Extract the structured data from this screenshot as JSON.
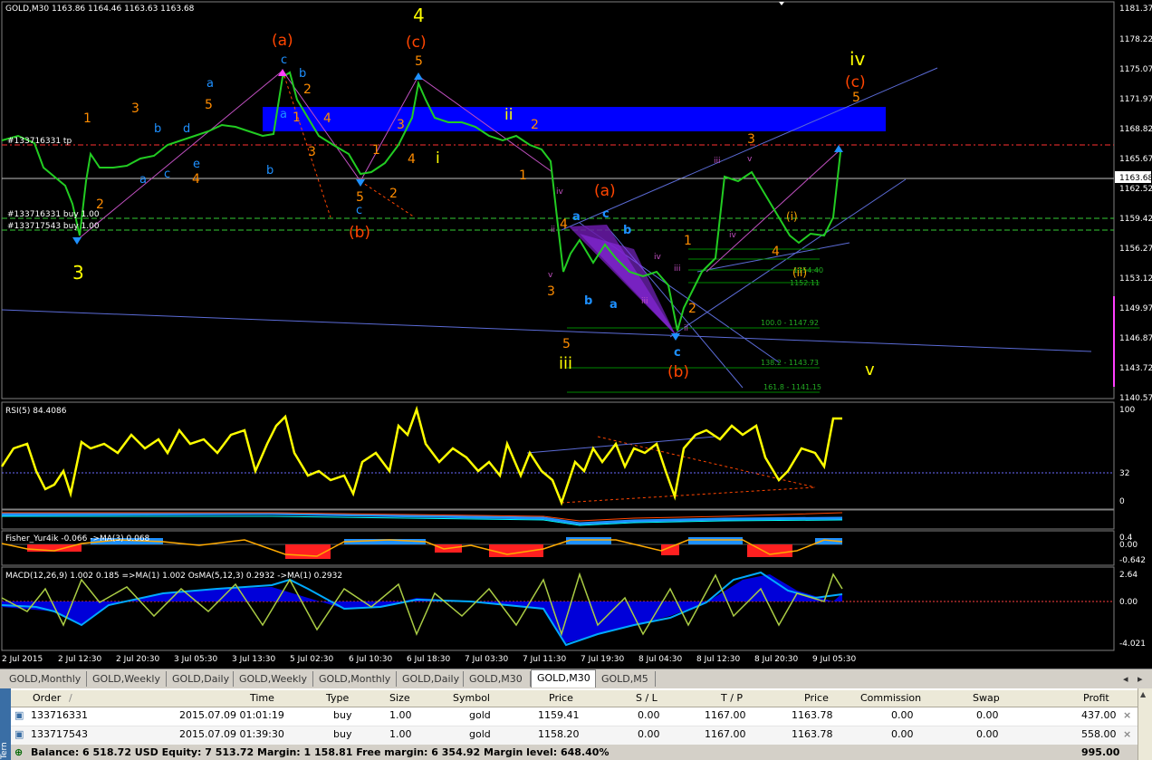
{
  "chart": {
    "symbol_info": "GOLD,M30  1163.86 1164.46 1163.63 1163.68",
    "current_price": "1163.68",
    "price_scale": [
      "1181.37",
      "1178.22",
      "1175.07",
      "1171.97",
      "1168.82",
      "1165.67",
      "1162.52",
      "1159.42",
      "1156.27",
      "1153.12",
      "1149.97",
      "1146.87",
      "1143.72",
      "1140.57"
    ],
    "order_labels": [
      "#133716331 tp",
      "#133716331 buy 1.00",
      "#133717543 buy 1.00"
    ],
    "fib_labels": [
      "100.0 - 1147.92",
      "138.2 - 1143.73",
      "161.8 - 1141.15",
      "1152.11",
      "1154.40"
    ],
    "wave_labels": {
      "big_4": "4",
      "big_3": "3",
      "a_paren_left": "(a)",
      "c_paren_top": "(c)",
      "b_paren": "(b)",
      "a_paren_mid": "(a)",
      "b_paren_bottom": "(b)",
      "iv": "iv",
      "c_paren_right": "(c)",
      "five_right": "5",
      "v": "v",
      "iii": "iii",
      "ii": "ii",
      "i": "i",
      "two": "2",
      "three": "3",
      "one": "1",
      "five": "5",
      "four": "4",
      "a": "a",
      "b": "b",
      "c": "c",
      "d": "d",
      "e": "e",
      "ii_small": "ii",
      "iii_small": "iii",
      "iv_small": "iv",
      "v_small": "v",
      "i_paren": "(i)",
      "ii_paren": "(ii)"
    },
    "rsi": {
      "title": "RSI(5) 84.4086",
      "scale": [
        "100",
        "32",
        "0"
      ]
    },
    "fisher": {
      "title": "Fisher_Yur4ik -0.066  ->MA(3) 0.068",
      "scale": [
        "0.4",
        "0.00",
        "-0.642"
      ]
    },
    "macd": {
      "title": "MACD(12,26,9) 1.002  0.185  =>MA(1) 1.002  OsMA(5,12,3) 0.2932  ->MA(1) 0.2932",
      "scale": [
        "2.64",
        "0.00",
        "-4.021"
      ]
    },
    "time_axis": [
      "2 Jul 2015",
      "2 Jul 12:30",
      "2 Jul 20:30",
      "3 Jul 05:30",
      "3 Jul 13:30",
      "5 Jul 02:30",
      "6 Jul 10:30",
      "6 Jul 18:30",
      "7 Jul 03:30",
      "7 Jul 11:30",
      "7 Jul 19:30",
      "8 Jul 04:30",
      "8 Jul 12:30",
      "8 Jul 20:30",
      "9 Jul 05:30"
    ],
    "colors": {
      "background": "#000000",
      "zone": "#0000ff",
      "rsi": "#ffff00",
      "wave_orange": "#ff4500",
      "wave_yellow": "#ffff00",
      "wave_cyan": "#1e90ff",
      "grid_green": "#00aa00"
    }
  },
  "tabs": [
    "GOLD,Monthly",
    "GOLD,Weekly",
    "GOLD,Daily",
    "GOLD,Weekly",
    "GOLD,Monthly",
    "GOLD,Daily",
    "GOLD,M30",
    "GOLD,M30",
    "GOLD,M5"
  ],
  "active_tab": "GOLD,M30",
  "terminal": {
    "columns": [
      "Order",
      "/",
      "Time",
      "Type",
      "Size",
      "Symbol",
      "Price",
      "S / L",
      "T / P",
      "Price",
      "Commission",
      "Swap",
      "Profit"
    ],
    "rows": [
      {
        "order": "133716331",
        "time": "2015.07.09 01:01:19",
        "type": "buy",
        "size": "1.00",
        "symbol": "gold",
        "price": "1159.41",
        "sl": "0.00",
        "tp": "1167.00",
        "cur": "1163.78",
        "commission": "0.00",
        "swap": "0.00",
        "profit": "437.00"
      },
      {
        "order": "133717543",
        "time": "2015.07.09 01:39:30",
        "type": "buy",
        "size": "1.00",
        "symbol": "gold",
        "price": "1158.20",
        "sl": "0.00",
        "tp": "1167.00",
        "cur": "1163.78",
        "commission": "0.00",
        "swap": "0.00",
        "profit": "558.00"
      }
    ],
    "status": "Balance: 6 518.72 USD  Equity: 7 513.72  Margin: 1 158.81  Free margin: 6 354.92  Margin level: 648.40%",
    "total_profit": "995.00",
    "side_label": "Terminal"
  }
}
